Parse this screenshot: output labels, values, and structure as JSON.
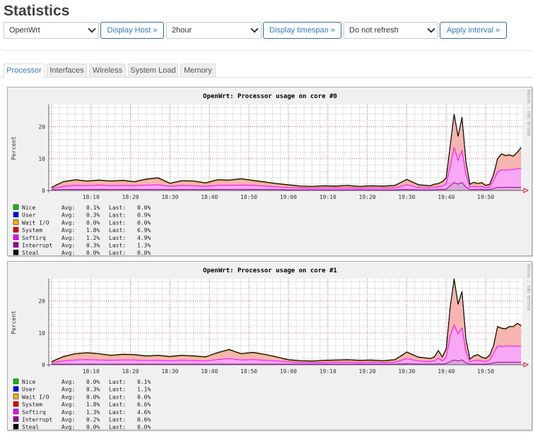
{
  "page": {
    "title": "Statistics"
  },
  "controls": {
    "host_select": {
      "value": "OpenWrt"
    },
    "display_host_button": "Display Host »",
    "timespan_select": {
      "value": "2hour"
    },
    "display_timespan_button": "Display timespan »",
    "refresh_select": {
      "value": "Do not refresh"
    },
    "apply_interval_button": "Apply interval »"
  },
  "tabs": [
    {
      "label": "Processor",
      "active": true
    },
    {
      "label": "Interfaces",
      "active": false
    },
    {
      "label": "Wireless",
      "active": false
    },
    {
      "label": "System Load",
      "active": false
    },
    {
      "label": "Memory",
      "active": false
    }
  ],
  "chart_data": [
    {
      "type": "area",
      "stacked": true,
      "title": "OpenWrt: Processor usage on core #0",
      "ylabel": "Percent",
      "xlabel": "",
      "watermark": "RRDTOOL / TOBI OETIKER",
      "ylim": [
        0,
        27
      ],
      "y_ticks": [
        0,
        10,
        20
      ],
      "y_major_step": 10,
      "y_minor_step": 2,
      "x_unit": "minutes since 18:00",
      "x_range": [
        -0.7,
        119.3
      ],
      "x_major_step": 10,
      "x_minor_step": 2,
      "x_ticks": [
        {
          "t": 10,
          "label": "18:10"
        },
        {
          "t": 20,
          "label": "18:20"
        },
        {
          "t": 30,
          "label": "18:30"
        },
        {
          "t": 40,
          "label": "18:40"
        },
        {
          "t": 50,
          "label": "18:50"
        },
        {
          "t": 60,
          "label": "19:00"
        },
        {
          "t": 70,
          "label": "19:10"
        },
        {
          "t": 80,
          "label": "19:20"
        },
        {
          "t": 90,
          "label": "19:30"
        },
        {
          "t": 100,
          "label": "19:40"
        },
        {
          "t": 110,
          "label": "19:50"
        }
      ],
      "grid": true,
      "legend_position": "bottom-left",
      "t": [
        0,
        3,
        6,
        9,
        12,
        15,
        18,
        21,
        24,
        27,
        30,
        33,
        36,
        39,
        42,
        45,
        48,
        51,
        54,
        57,
        60,
        63,
        66,
        69,
        72,
        75,
        78,
        81,
        84,
        87,
        90,
        93,
        96,
        97,
        98,
        99,
        100,
        101,
        102,
        103,
        104,
        105,
        106,
        107,
        108,
        109,
        110,
        111,
        112,
        113,
        114,
        115,
        116,
        117,
        118,
        119
      ],
      "stack_order": [
        "Interrupt",
        "Softirq",
        "System",
        "Wait I/O",
        "User",
        "Nice",
        "Steal"
      ],
      "series": [
        {
          "name": "Nice",
          "color": "#00c000",
          "fill": "#b0f0b0",
          "avg": "0.1%",
          "last": "0.0%",
          "values": 0.05
        },
        {
          "name": "User",
          "color": "#0000ff",
          "fill": "#b0b0ff",
          "avg": "0.3%",
          "last": "0.9%",
          "values": 0.15
        },
        {
          "name": "Wait I/O",
          "color": "#ffb000",
          "fill": "#ffe8b0",
          "avg": "0.0%",
          "last": "0.0%",
          "values": 0
        },
        {
          "name": "System",
          "color": "#e00000",
          "fill": "#f8b4b0",
          "avg": "1.8%",
          "last": "6.9%",
          "values": [
            0.2,
            1.3,
            1.6,
            1.3,
            1.4,
            1.3,
            1.4,
            1.1,
            1.7,
            2.0,
            0.8,
            1.3,
            1.3,
            0.9,
            1.6,
            1.5,
            1.8,
            1.4,
            1.1,
            0.8,
            0.7,
            0.4,
            0.4,
            0.5,
            0.4,
            0.6,
            0.4,
            0.5,
            0.4,
            0.6,
            1.5,
            0.7,
            0.5,
            0.8,
            0.8,
            1.2,
            1.8,
            6.3,
            10.3,
            7.3,
            10.3,
            3.8,
            0.7,
            1.1,
            0.8,
            1.0,
            0.6,
            0.7,
            1.7,
            4.0,
            4.8,
            4.4,
            4.5,
            4.0,
            5.0,
            6.3
          ]
        },
        {
          "name": "Softirq",
          "color": "#ff00ff",
          "fill": "#f8a8f4",
          "avg": "1.2%",
          "last": "4.9%",
          "values": [
            0.4,
            1.0,
            1.3,
            1.2,
            1.4,
            1.2,
            1.3,
            1.2,
            1.4,
            1.5,
            1.0,
            1.3,
            1.2,
            1.0,
            1.3,
            1.3,
            1.4,
            1.3,
            1.1,
            0.9,
            0.7,
            0.6,
            0.5,
            0.6,
            0.6,
            0.6,
            0.5,
            0.6,
            0.6,
            0.6,
            1.5,
            0.7,
            0.6,
            0.8,
            0.9,
            1.1,
            1.6,
            6.0,
            11.0,
            7.5,
            10.0,
            4.0,
            0.8,
            1.0,
            0.9,
            1.0,
            0.6,
            0.8,
            2.5,
            4.8,
            5.5,
            5.4,
            5.5,
            5.6,
            5.8,
            6.0
          ]
        },
        {
          "name": "Interrupt",
          "color": "#a000a0",
          "fill": "#d8a8d8",
          "avg": "0.3%",
          "last": "1.3%",
          "values": [
            0.2,
            0.3,
            0.3,
            0.3,
            0.3,
            0.3,
            0.3,
            0.3,
            0.3,
            0.3,
            0.3,
            0.3,
            0.3,
            0.3,
            0.3,
            0.3,
            0.3,
            0.3,
            0.3,
            0.3,
            0.2,
            0.2,
            0.2,
            0.2,
            0.2,
            0.2,
            0.2,
            0.2,
            0.2,
            0.2,
            0.3,
            0.2,
            0.2,
            0.2,
            0.3,
            0.3,
            0.4,
            1.5,
            2.5,
            2.0,
            2.5,
            1.0,
            0.3,
            0.3,
            0.3,
            0.3,
            0.2,
            0.3,
            0.6,
            1.0,
            1.0,
            1.0,
            1.0,
            1.0,
            1.0,
            1.0
          ]
        },
        {
          "name": "Steal",
          "color": "#000000",
          "fill": "#b0b0b0",
          "avg": "0.0%",
          "last": "0.0%",
          "values": 0
        }
      ],
      "legend_labels": {
        "avg": "Avg:",
        "last": "Last:"
      }
    },
    {
      "type": "area",
      "stacked": true,
      "title": "OpenWrt: Processor usage on core #1",
      "ylabel": "Percent",
      "xlabel": "",
      "watermark": "RRDTOOL / TOBI OETIKER",
      "ylim": [
        0,
        30
      ],
      "y_ticks": [
        0,
        10,
        20
      ],
      "y_major_step": 10,
      "y_minor_step": 2,
      "x_unit": "minutes since 18:00",
      "x_range": [
        -0.7,
        119.3
      ],
      "x_major_step": 10,
      "x_minor_step": 2,
      "x_ticks": [
        {
          "t": 10,
          "label": "18:10"
        },
        {
          "t": 20,
          "label": "18:20"
        },
        {
          "t": 30,
          "label": "18:30"
        },
        {
          "t": 40,
          "label": "18:40"
        },
        {
          "t": 50,
          "label": "18:50"
        },
        {
          "t": 60,
          "label": "19:00"
        },
        {
          "t": 70,
          "label": "19:10"
        },
        {
          "t": 80,
          "label": "19:20"
        },
        {
          "t": 90,
          "label": "19:30"
        },
        {
          "t": 100,
          "label": "19:40"
        },
        {
          "t": 110,
          "label": "19:50"
        }
      ],
      "grid": true,
      "legend_position": "bottom-left",
      "t": [
        0,
        3,
        6,
        9,
        12,
        15,
        18,
        21,
        24,
        27,
        30,
        33,
        36,
        39,
        42,
        45,
        48,
        51,
        54,
        57,
        60,
        63,
        66,
        69,
        72,
        75,
        78,
        81,
        84,
        87,
        90,
        93,
        96,
        97,
        98,
        99,
        100,
        101,
        102,
        103,
        104,
        105,
        106,
        107,
        108,
        109,
        110,
        111,
        112,
        113,
        114,
        115,
        116,
        117,
        118,
        119
      ],
      "stack_order": [
        "Interrupt",
        "Softirq",
        "System",
        "Wait I/O",
        "User",
        "Nice",
        "Steal"
      ],
      "series": [
        {
          "name": "Nice",
          "color": "#00c000",
          "fill": "#b0f0b0",
          "avg": "0.0%",
          "last": "0.1%",
          "values": 0.05
        },
        {
          "name": "User",
          "color": "#0000ff",
          "fill": "#b0b0ff",
          "avg": "0.3%",
          "last": "1.1%",
          "values": 0.15
        },
        {
          "name": "Wait I/O",
          "color": "#ffb000",
          "fill": "#ffe8b0",
          "avg": "0.0%",
          "last": "0.0%",
          "values": 0
        },
        {
          "name": "System",
          "color": "#e00000",
          "fill": "#f8b4b0",
          "avg": "1.8%",
          "last": "6.6%",
          "values": [
            0.2,
            1.2,
            1.8,
            2.0,
            1.8,
            1.4,
            1.6,
            1.5,
            1.3,
            1.4,
            1.2,
            1.4,
            1.3,
            1.1,
            2.0,
            2.7,
            1.8,
            2.1,
            1.7,
            1.1,
            0.5,
            0.4,
            0.3,
            0.5,
            0.5,
            0.6,
            0.5,
            0.5,
            0.4,
            0.6,
            1.9,
            1.0,
            0.8,
            1.1,
            2.2,
            1.1,
            2.4,
            8.8,
            14.3,
            9.1,
            11.3,
            3.7,
            0.7,
            1.3,
            1.6,
            1.0,
            0.8,
            1.3,
            2.2,
            6.0,
            5.5,
            5.3,
            5.8,
            6.0,
            7.0,
            6.3
          ]
        },
        {
          "name": "Softirq",
          "color": "#ff00ff",
          "fill": "#f8a8f4",
          "avg": "1.3%",
          "last": "4.6%",
          "values": [
            0.4,
            1.0,
            1.3,
            1.4,
            1.3,
            1.2,
            1.3,
            1.3,
            1.1,
            1.2,
            1.0,
            1.2,
            1.1,
            1.0,
            1.4,
            1.7,
            1.3,
            1.4,
            1.2,
            1.0,
            0.7,
            0.5,
            0.5,
            0.5,
            0.6,
            0.6,
            0.5,
            0.6,
            0.5,
            0.6,
            1.6,
            1.0,
            0.8,
            1.0,
            1.8,
            1.0,
            2.0,
            8.0,
            11.0,
            8.5,
            10.0,
            3.5,
            0.7,
            1.1,
            1.2,
            1.0,
            0.8,
            1.2,
            3.0,
            5.0,
            5.0,
            5.0,
            5.2,
            5.0,
            5.0,
            5.0
          ]
        },
        {
          "name": "Interrupt",
          "color": "#a000a0",
          "fill": "#d8a8d8",
          "avg": "0.2%",
          "last": "0.6%",
          "values": [
            0.2,
            0.2,
            0.2,
            0.2,
            0.2,
            0.2,
            0.2,
            0.2,
            0.2,
            0.2,
            0.2,
            0.2,
            0.2,
            0.2,
            0.2,
            0.2,
            0.2,
            0.2,
            0.2,
            0.2,
            0.2,
            0.2,
            0.2,
            0.2,
            0.2,
            0.2,
            0.2,
            0.2,
            0.2,
            0.2,
            0.3,
            0.2,
            0.2,
            0.2,
            0.3,
            0.2,
            0.4,
            1.0,
            1.5,
            1.2,
            1.5,
            0.6,
            0.2,
            0.2,
            0.2,
            0.2,
            0.2,
            0.3,
            0.6,
            0.8,
            0.8,
            0.8,
            0.8,
            0.8,
            0.8,
            0.8
          ]
        },
        {
          "name": "Steal",
          "color": "#000000",
          "fill": "#b0b0b0",
          "avg": "0.0%",
          "last": "0.0%",
          "values": 0
        }
      ],
      "legend_labels": {
        "avg": "Avg:",
        "last": "Last:"
      }
    }
  ]
}
